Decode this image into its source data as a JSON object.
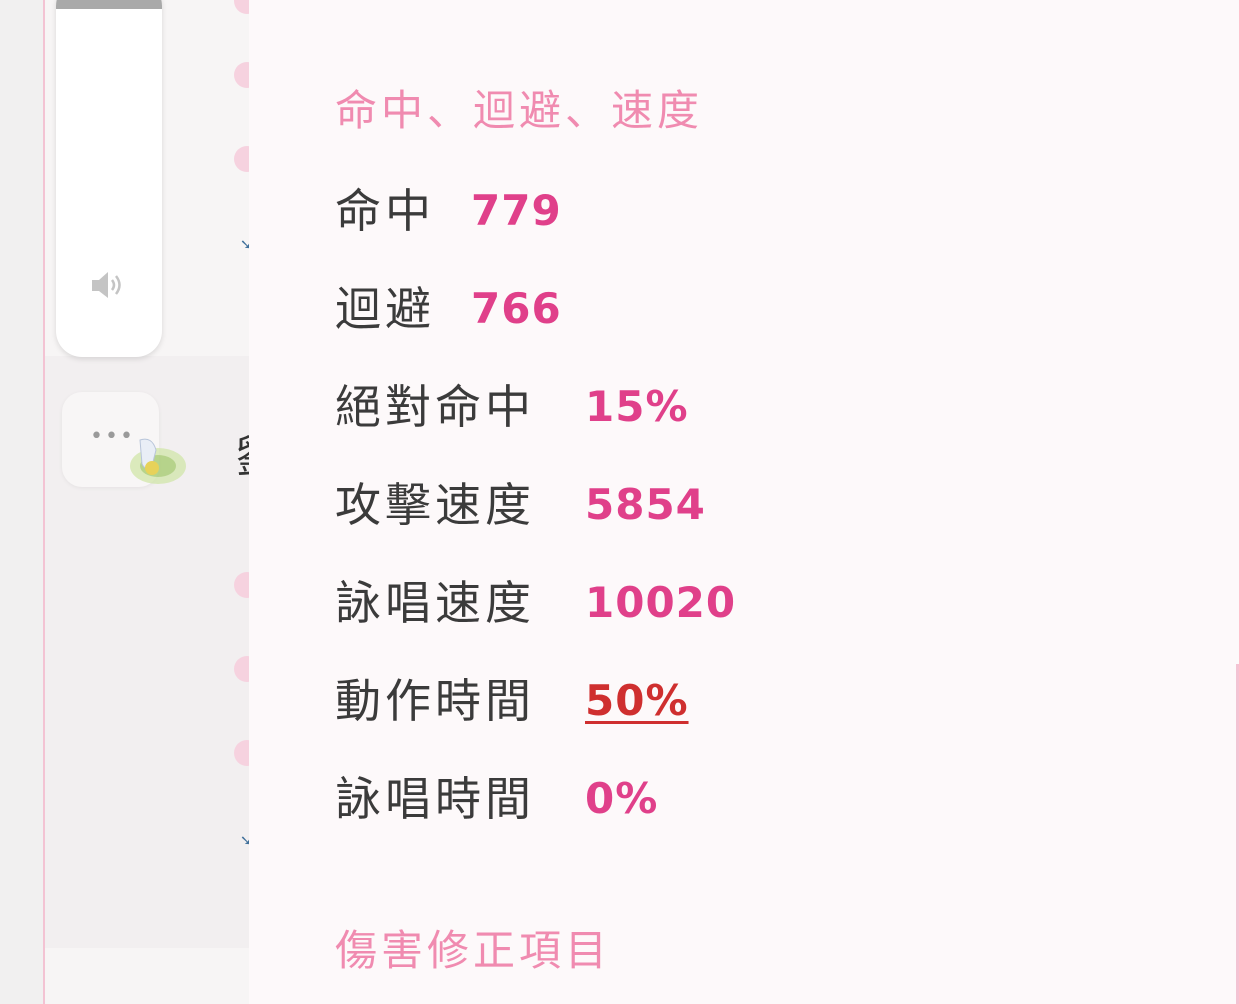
{
  "panel": {
    "sections": {
      "hit_evasion_speed": {
        "title": "命中、迴避、速度",
        "rows": [
          {
            "label": "命中",
            "value": "779"
          },
          {
            "label": "迴避",
            "value": "766"
          },
          {
            "label": "絕對命中",
            "value": "15%"
          },
          {
            "label": "攻擊速度",
            "value": "5854"
          },
          {
            "label": "詠唱速度",
            "value": "10020"
          },
          {
            "label": "動作時間",
            "value": "50%"
          },
          {
            "label": "詠唱時間",
            "value": "0%"
          }
        ]
      },
      "damage_modifiers": {
        "title": "傷害修正項目"
      }
    }
  },
  "background": {
    "partial_text": "劉"
  },
  "icons": {
    "volume": "volume-icon",
    "more": "more-options-icon",
    "wizard": "wizard-character-icon"
  },
  "colors": {
    "section_title": "#f08bb0",
    "stat_value": "#e0408a",
    "stat_value_highlight": "#cf2f2f",
    "panel_background": "#fdf9fa"
  }
}
